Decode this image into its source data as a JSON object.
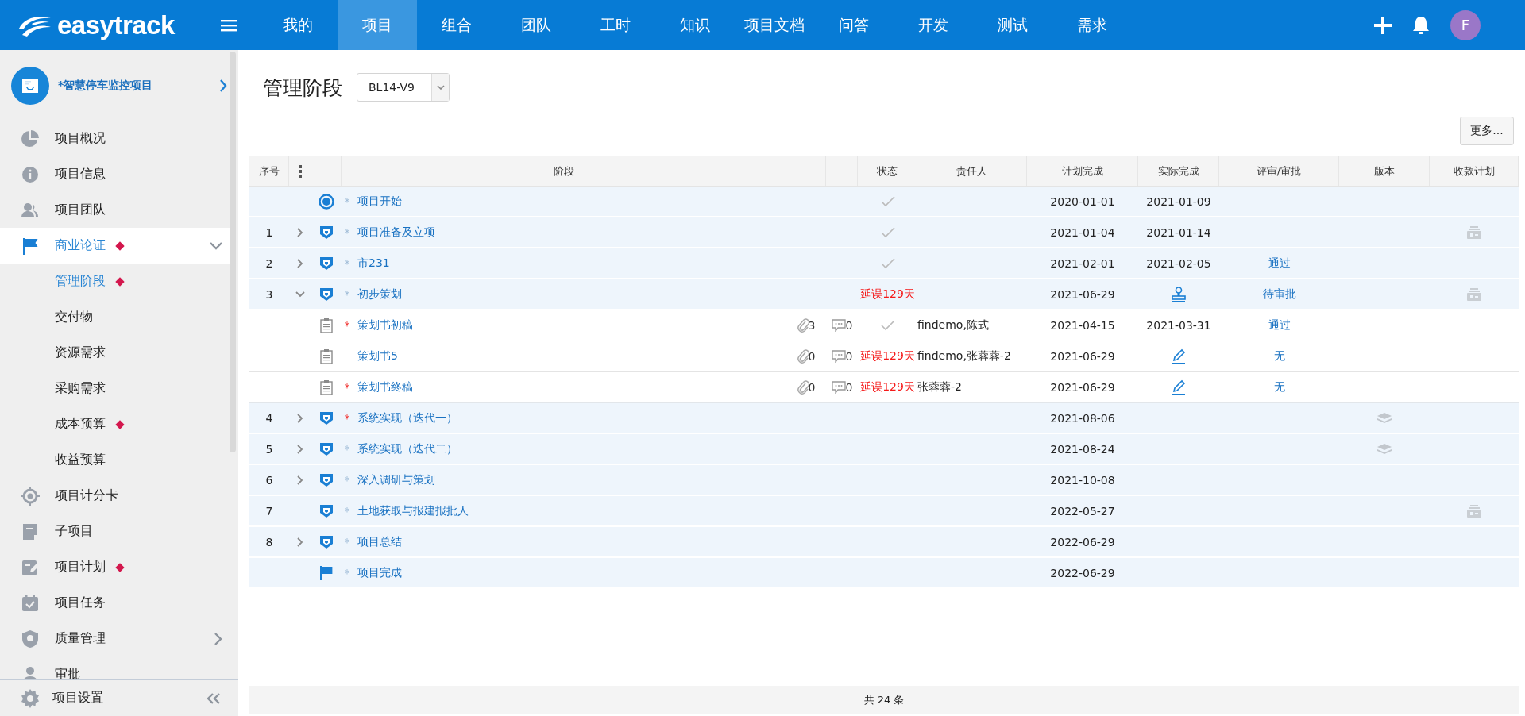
{
  "topbar": {
    "logo": "easytrack",
    "nav": [
      {
        "label": "我的",
        "selected": false
      },
      {
        "label": "项目",
        "selected": true
      },
      {
        "label": "组合",
        "selected": false
      },
      {
        "label": "团队",
        "selected": false
      },
      {
        "label": "工时",
        "selected": false
      },
      {
        "label": "知识",
        "selected": false
      },
      {
        "label": "项目文档",
        "selected": false
      },
      {
        "label": "问答",
        "selected": false
      },
      {
        "label": "开发",
        "selected": false
      },
      {
        "label": "测试",
        "selected": false
      },
      {
        "label": "需求",
        "selected": false
      }
    ],
    "avatar": "F"
  },
  "sidebar": {
    "project": "*智慧停车监控项目",
    "items": [
      {
        "label": "项目概况",
        "selected": false,
        "flagged": false
      },
      {
        "label": "项目信息",
        "selected": false,
        "flagged": false
      },
      {
        "label": "项目团队",
        "selected": false,
        "flagged": false
      },
      {
        "label": "商业论证",
        "selected": true,
        "flagged": true,
        "expanded": true,
        "children": [
          {
            "label": "管理阶段",
            "selected": true,
            "flagged": true
          },
          {
            "label": "交付物",
            "selected": false,
            "flagged": false
          },
          {
            "label": "资源需求",
            "selected": false,
            "flagged": false
          },
          {
            "label": "采购需求",
            "selected": false,
            "flagged": false
          },
          {
            "label": "成本预算",
            "selected": false,
            "flagged": true
          },
          {
            "label": "收益预算",
            "selected": false,
            "flagged": false
          }
        ]
      },
      {
        "label": "项目计分卡",
        "selected": false,
        "flagged": false
      },
      {
        "label": "子项目",
        "selected": false,
        "flagged": false
      },
      {
        "label": "项目计划",
        "selected": false,
        "flagged": true
      },
      {
        "label": "项目任务",
        "selected": false,
        "flagged": false
      },
      {
        "label": "质量管理",
        "selected": false,
        "flagged": false,
        "expanded": false
      },
      {
        "label": "审批",
        "selected": false,
        "flagged": false
      }
    ],
    "settings": "项目设置"
  },
  "page": {
    "title": "管理阶段",
    "version_select": "BL14-V9",
    "more_button": "更多..."
  },
  "table": {
    "columns": [
      {
        "kind": "label",
        "label": "序号"
      },
      {
        "kind": "menu"
      },
      {
        "kind": "blank"
      },
      {
        "kind": "label",
        "label": "阶段"
      },
      {
        "kind": "blank"
      },
      {
        "kind": "blank"
      },
      {
        "kind": "label",
        "label": "状态"
      },
      {
        "kind": "label",
        "label": "责任人"
      },
      {
        "kind": "label",
        "label": "计划完成"
      },
      {
        "kind": "label",
        "label": "实际完成"
      },
      {
        "kind": "label",
        "label": "评审/审批"
      },
      {
        "kind": "label",
        "label": "版本"
      },
      {
        "kind": "label",
        "label": "收款计划"
      }
    ],
    "rows": [
      {
        "kind": "start",
        "mark": "*",
        "required": false,
        "name": "项目开始",
        "status": {
          "kind": "done"
        },
        "planned": "2020-01-01",
        "actual": {
          "kind": "date",
          "text": "2021-01-09"
        }
      },
      {
        "no": "1",
        "expanded": false,
        "kind": "phase",
        "mark": "*",
        "required": false,
        "name": "项目准备及立项",
        "status": {
          "kind": "done"
        },
        "planned": "2021-01-04",
        "actual": {
          "kind": "date",
          "text": "2021-01-14"
        },
        "payment_icon": true
      },
      {
        "no": "2",
        "expanded": false,
        "kind": "phase",
        "mark": "*",
        "required": false,
        "name": "市231",
        "status": {
          "kind": "done"
        },
        "planned": "2021-02-01",
        "actual": {
          "kind": "date",
          "text": "2021-02-05"
        },
        "review": "通过"
      },
      {
        "no": "3",
        "expanded": true,
        "kind": "phase",
        "mark": "*",
        "required": false,
        "name": "初步策划",
        "status": {
          "kind": "delayed",
          "text": "延误129天"
        },
        "planned": "2021-06-29",
        "actual": {
          "kind": "stamp"
        },
        "review": "待审批",
        "payment_icon": true,
        "children": [
          {
            "kind": "deliverable",
            "mark": "*",
            "required": true,
            "name": "策划书初稿",
            "attachments": "3",
            "comments": "0",
            "status": {
              "kind": "done"
            },
            "owner": "findemo,陈式",
            "planned": "2021-04-15",
            "actual": {
              "kind": "date",
              "text": "2021-03-31"
            },
            "review": "通过"
          },
          {
            "kind": "deliverable",
            "name": "策划书5",
            "attachments": "0",
            "comments": "0",
            "status": {
              "kind": "delayed",
              "text": "延误129天"
            },
            "owner": "findemo,张蓉蓉-2",
            "planned": "2021-06-29",
            "actual": {
              "kind": "edit"
            },
            "review": "无"
          },
          {
            "kind": "deliverable",
            "mark": "*",
            "required": true,
            "name": "策划书终稿",
            "attachments": "0",
            "comments": "0",
            "status": {
              "kind": "delayed",
              "text": "延误129天"
            },
            "owner": "张蓉蓉-2",
            "planned": "2021-06-29",
            "actual": {
              "kind": "edit"
            },
            "review": "无"
          }
        ]
      },
      {
        "no": "4",
        "expanded": false,
        "kind": "phase",
        "mark": "*",
        "required": true,
        "name": "系统实现（迭代一）",
        "planned": "2021-08-06",
        "version_icon": true
      },
      {
        "no": "5",
        "expanded": false,
        "kind": "phase",
        "mark": "*",
        "required": false,
        "name": "系统实现（迭代二）",
        "planned": "2021-08-24",
        "version_icon": true
      },
      {
        "no": "6",
        "expanded": false,
        "kind": "phase",
        "mark": "*",
        "required": false,
        "name": "深入调研与策划",
        "planned": "2021-10-08"
      },
      {
        "no": "7",
        "kind": "phase",
        "mark": "*",
        "required": false,
        "name": "土地获取与报建报批人",
        "planned": "2022-05-27",
        "payment_icon": true
      },
      {
        "no": "8",
        "expanded": false,
        "kind": "phase",
        "mark": "*",
        "required": false,
        "name": "项目总结",
        "planned": "2022-06-29"
      },
      {
        "kind": "end",
        "mark": "*",
        "required": false,
        "name": "项目完成",
        "planned": "2022-06-29"
      }
    ],
    "footer": "共 24 条"
  }
}
